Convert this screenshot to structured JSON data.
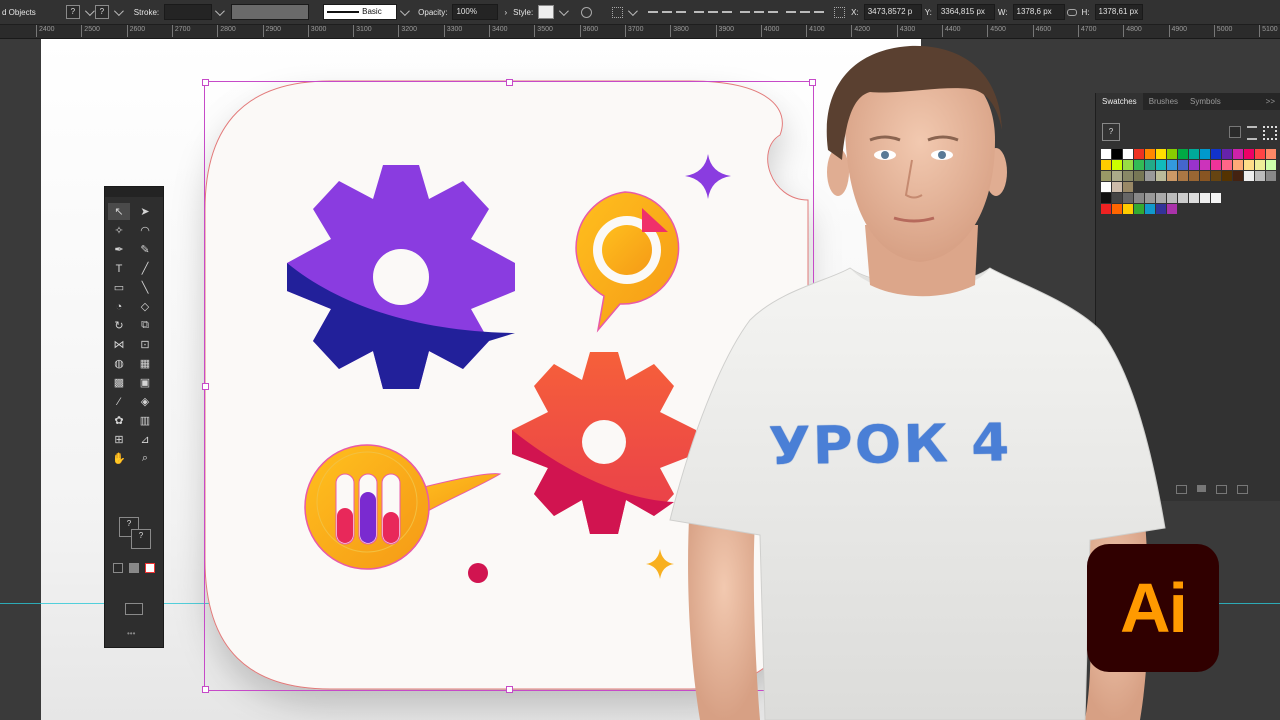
{
  "control_bar": {
    "objects_label": "d Objects",
    "stroke_label": "Stroke:",
    "stroke_profile": "Basic",
    "opacity_label": "Opacity:",
    "opacity_value": "100%",
    "style_label": "Style:",
    "x_label": "X:",
    "x_value": "3473,8572 p",
    "y_label": "Y:",
    "y_value": "3364,815 px",
    "w_label": "W:",
    "w_value": "1378,6 px",
    "h_label": "H:",
    "h_value": "1378,61 px"
  },
  "ruler": {
    "ticks": [
      "2400",
      "2500",
      "2600",
      "2700",
      "2800",
      "2900",
      "3000",
      "3100",
      "3200",
      "3300",
      "3400",
      "3500",
      "3600",
      "3700",
      "3800",
      "3900",
      "4000",
      "4100",
      "4200",
      "4300",
      "4400",
      "4500",
      "4600",
      "4700",
      "4800",
      "4900",
      "5000",
      "5100"
    ]
  },
  "swatches_panel": {
    "tabs": [
      "Swatches",
      "Brushes",
      "Symbols"
    ],
    "active_tab": "Swatches",
    "menu_icon": ">>"
  },
  "overlay": {
    "tshirt_text": "УРОК 4",
    "logo_text": "Ai"
  },
  "colors": {
    "gear_purple": "#8a3ce0",
    "gear_navy": "#22209a",
    "gear_red": "#f0503a",
    "gear_crimson": "#d11450",
    "amber": "#f8b020",
    "selection": "#c64ac8",
    "logo_bg": "#300000",
    "logo_fg": "#ff9a00"
  }
}
